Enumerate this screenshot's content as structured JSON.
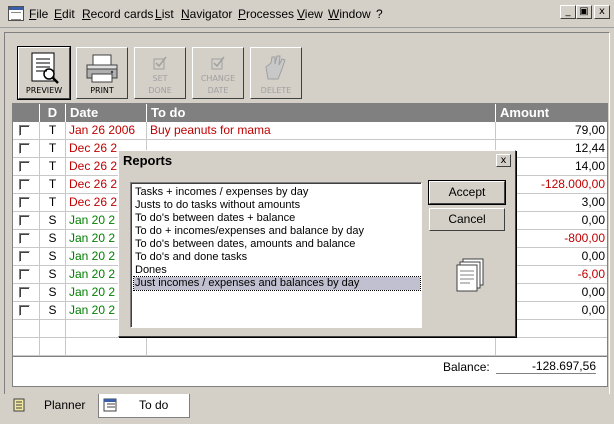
{
  "menubar": {
    "items": [
      "File",
      "Edit",
      "Record cards",
      "List",
      "Navigator",
      "Processes",
      "View",
      "Window",
      "?"
    ]
  },
  "window_controls": {
    "minimize": "_",
    "restore": "▣",
    "close": "x"
  },
  "toolbar": {
    "preview": "PREVIEW",
    "print": "PRINT",
    "set_done": [
      "SET",
      "DONE"
    ],
    "change_date": [
      "CHANGE",
      "DATE"
    ],
    "delete": "DELETE"
  },
  "grid": {
    "headers": {
      "check": "",
      "d": "D",
      "date": "Date",
      "todo": "To do",
      "amount": "Amount"
    },
    "rows": [
      {
        "d": "T",
        "date": "Jan 26 2006",
        "todo": "Buy peanuts for mama",
        "amount": "79,00",
        "color": "red",
        "amount_color": "black"
      },
      {
        "d": "T",
        "date": "Dec 26 2",
        "todo": "",
        "amount": "12,44",
        "color": "red",
        "amount_color": "black"
      },
      {
        "d": "T",
        "date": "Dec 26 2",
        "todo": "",
        "amount": "14,00",
        "color": "red",
        "amount_color": "black"
      },
      {
        "d": "T",
        "date": "Dec 26 2",
        "todo": "",
        "amount": "-128.000,00",
        "color": "red",
        "amount_color": "red"
      },
      {
        "d": "T",
        "date": "Dec 26 2",
        "todo": "",
        "amount": "3,00",
        "color": "red",
        "amount_color": "black"
      },
      {
        "d": "S",
        "date": "Jan 20 2",
        "todo": "",
        "amount": "0,00",
        "color": "green",
        "amount_color": "black"
      },
      {
        "d": "S",
        "date": "Jan 20 2",
        "todo": "",
        "amount": "-800,00",
        "color": "green",
        "amount_color": "red"
      },
      {
        "d": "S",
        "date": "Jan 20 2",
        "todo": "",
        "amount": "0,00",
        "color": "green",
        "amount_color": "black"
      },
      {
        "d": "S",
        "date": "Jan 20 2",
        "todo": "",
        "amount": "-6,00",
        "color": "green",
        "amount_color": "red"
      },
      {
        "d": "S",
        "date": "Jan 20 2",
        "todo": "",
        "amount": "0,00",
        "color": "green",
        "amount_color": "black"
      },
      {
        "d": "S",
        "date": "Jan 20 2",
        "todo": "",
        "amount": "0,00",
        "color": "green",
        "amount_color": "black"
      }
    ],
    "balance_label": "Balance:",
    "balance_value": "-128.697,56"
  },
  "tabs": {
    "planner": "Planner",
    "todo": "To do"
  },
  "dialog": {
    "title": "Reports",
    "close": "x",
    "reports": [
      "Tasks + incomes / expenses by day",
      "Justs to do tasks without amounts",
      "To do's between dates + balance",
      "To do + incomes/expenses and balance by day",
      "To do's between dates, amounts and balance",
      "To do's and done tasks",
      "Dones",
      "Just incomes / expenses and balances by day"
    ],
    "selected_index": 7,
    "accept": "Accept",
    "cancel": "Cancel"
  },
  "colors": {
    "red": "#c00000",
    "green": "#008000",
    "header_bg": "#808080",
    "face": "#d4d0c8"
  }
}
